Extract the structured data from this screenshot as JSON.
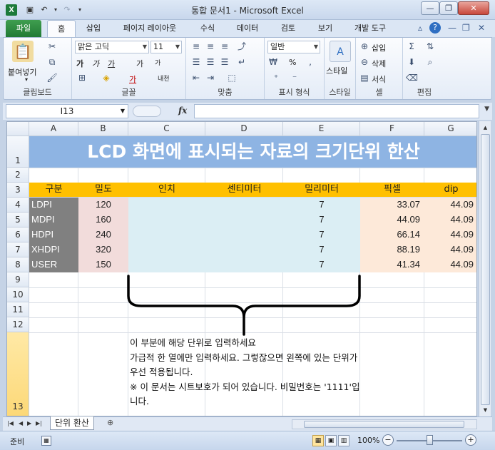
{
  "window": {
    "title": "통합 문서1 - Microsoft Excel",
    "app_icon_label": "X",
    "controls": {
      "minimize": "—",
      "restore": "❐",
      "close": "✕"
    }
  },
  "ribbon_tabs": [
    "파일",
    "홈",
    "삽입",
    "페이지 레이아웃",
    "수식",
    "데이터",
    "검토",
    "보기",
    "개발 도구"
  ],
  "active_tab": "홈",
  "ribbon": {
    "clipboard": {
      "label": "클립보드",
      "paste": "붙여넣기"
    },
    "font": {
      "label": "글꼴",
      "font_name": "맑은 고딕",
      "font_size": "11",
      "bold": "가",
      "italic": "가",
      "underline": "가",
      "grow": "가",
      "shrink": "가",
      "color": "가",
      "phonetic": "내천"
    },
    "alignment": {
      "label": "맞춤"
    },
    "number": {
      "label": "표시 형식",
      "format": "일반",
      "percent": "%"
    },
    "styles": {
      "label": "스타일",
      "button": "스타일"
    },
    "cells": {
      "label": "셀",
      "insert": "삽입",
      "delete": "삭제",
      "format": "서식"
    },
    "editing": {
      "label": "편집"
    }
  },
  "formula_bar": {
    "name_box": "I13",
    "fx": "fx",
    "value": ""
  },
  "grid": {
    "columns": [
      "A",
      "B",
      "C",
      "D",
      "E",
      "F",
      "G"
    ],
    "rows": [
      "1",
      "2",
      "3",
      "4",
      "5",
      "6",
      "7",
      "8",
      "9",
      "10",
      "11",
      "12",
      "13"
    ],
    "title": "LCD 화면에 표시되는 자료의 크기단위 한산",
    "headers": [
      "구분",
      "밀도",
      "인치",
      "센티미터",
      "밀리미터",
      "픽셀",
      "dip"
    ],
    "data": [
      {
        "name": "LDPI",
        "density": "120",
        "mm": "7",
        "pixel": "33.07",
        "dip": "44.09"
      },
      {
        "name": "MDPI",
        "density": "160",
        "mm": "7",
        "pixel": "44.09",
        "dip": "44.09"
      },
      {
        "name": "HDPI",
        "density": "240",
        "mm": "7",
        "pixel": "66.14",
        "dip": "44.09"
      },
      {
        "name": "XHDPI",
        "density": "320",
        "mm": "7",
        "pixel": "88.19",
        "dip": "44.09"
      },
      {
        "name": "USER",
        "density": "150",
        "mm": "7",
        "pixel": "41.34",
        "dip": "44.09"
      }
    ],
    "note": [
      "이 부분에 해당 단위로 입력하세요",
      "가급적 한 열에만 입력하세요. 그렇잖으면 왼쪽에 있는 단위가 우선 적용됩니다.",
      "※ 이 문서는 시트보호가 되어 있습니다. 비밀번호는 '1111'입니다."
    ]
  },
  "sheet_tabs": [
    "단위 환산"
  ],
  "status": {
    "text": "준비",
    "zoom": "100%"
  },
  "colors": {
    "title_bg": "#8eb4e3",
    "header_bg": "#ffc000",
    "name_bg": "#808080",
    "density_bg": "#f2dcdb",
    "input_bg": "#dbeef4",
    "output_bg": "#fde9d9",
    "file_tab": "#217a34"
  }
}
